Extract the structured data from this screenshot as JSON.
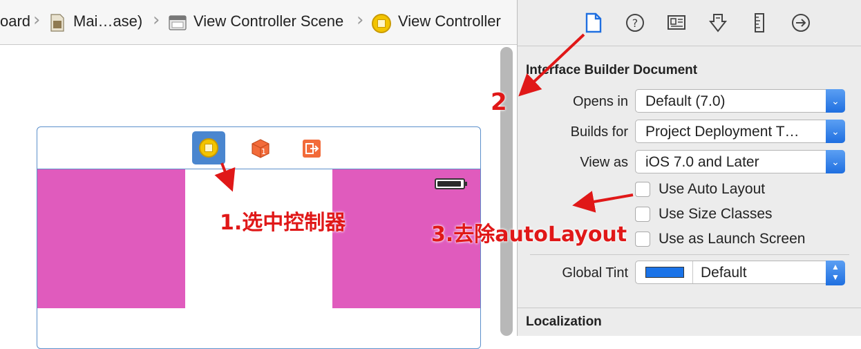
{
  "jumpbar": {
    "items": [
      {
        "label": "oard"
      },
      {
        "label": "Mai…ase)"
      },
      {
        "label": "View Controller Scene"
      },
      {
        "label": "View Controller"
      }
    ]
  },
  "inspector": {
    "tabs": [
      "file-icon",
      "help-icon",
      "identity-icon",
      "attributes-icon",
      "size-icon",
      "connections-icon"
    ],
    "ib_document": {
      "title": "Interface Builder Document",
      "opens_in": {
        "label": "Opens in",
        "value": "Default (7.0)"
      },
      "builds_for": {
        "label": "Builds for",
        "value": "Project Deployment T…"
      },
      "view_as": {
        "label": "View as",
        "value": "iOS 7.0 and Later"
      },
      "use_auto_layout": {
        "label": "Use Auto Layout",
        "checked": false
      },
      "use_size_classes": {
        "label": "Use Size Classes",
        "checked": false
      },
      "use_launch_screen": {
        "label": "Use as Launch Screen",
        "checked": false
      },
      "global_tint": {
        "label": "Global Tint",
        "value": "Default",
        "swatch": "#1a73e8"
      }
    },
    "localization": {
      "title": "Localization"
    }
  },
  "annotations": {
    "step1": "1.选中控制器",
    "step2": "2",
    "step3": "3.去除autoLayout"
  },
  "colors": {
    "accent": "#1f6fe0",
    "scene_pink": "#e05bbd",
    "annotation": "#e01818"
  }
}
